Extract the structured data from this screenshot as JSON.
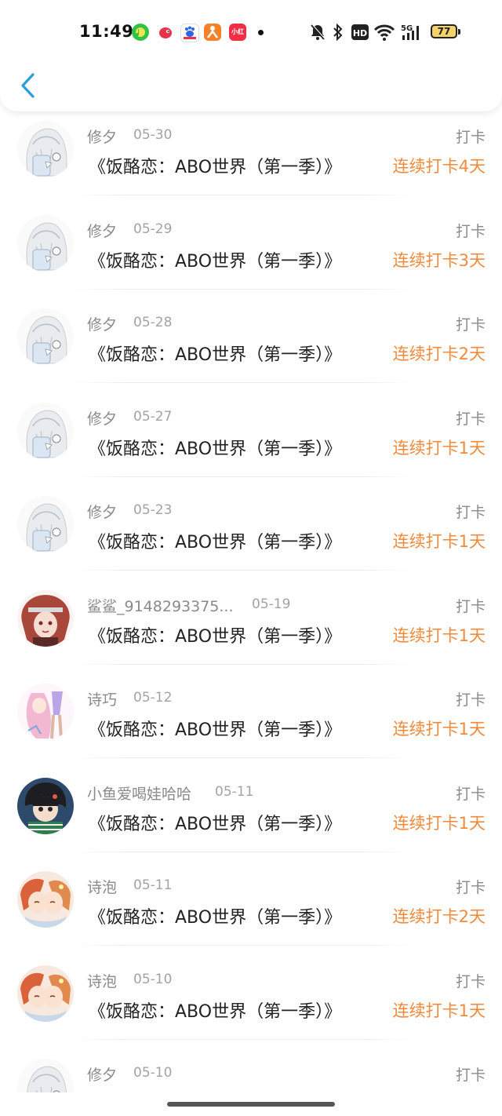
{
  "status_bar": {
    "time": "11:49",
    "app_icons": [
      "music-app-icon",
      "bird-app-icon",
      "baidu-app-icon",
      "person-app-icon",
      "xiaohongshu-app-icon"
    ],
    "xiaohongshu_text": "小红书",
    "battery_level": "77",
    "network": "5G"
  },
  "header": {
    "back_icon": "chevron-left-icon"
  },
  "colors": {
    "streak": "#f08a3c",
    "back": "#2d9cdb",
    "battery_fill": "#f4d46a"
  },
  "entries": [
    {
      "user": "修夕",
      "date": "05-30",
      "action": "打卡",
      "book": "《饭酪恋：ABO世界（第一季）》",
      "streak": "连续打卡4天",
      "avatar": "white-hair"
    },
    {
      "user": "修夕",
      "date": "05-29",
      "action": "打卡",
      "book": "《饭酪恋：ABO世界（第一季）》",
      "streak": "连续打卡3天",
      "avatar": "white-hair"
    },
    {
      "user": "修夕",
      "date": "05-28",
      "action": "打卡",
      "book": "《饭酪恋：ABO世界（第一季）》",
      "streak": "连续打卡2天",
      "avatar": "white-hair"
    },
    {
      "user": "修夕",
      "date": "05-27",
      "action": "打卡",
      "book": "《饭酪恋：ABO世界（第一季）》",
      "streak": "连续打卡1天",
      "avatar": "white-hair"
    },
    {
      "user": "修夕",
      "date": "05-23",
      "action": "打卡",
      "book": "《饭酪恋：ABO世界（第一季）》",
      "streak": "连续打卡1天",
      "avatar": "white-hair"
    },
    {
      "user": "鲨鲨_9148293375...",
      "date": "05-19",
      "action": "打卡",
      "book": "《饭酪恋：ABO世界（第一季）》",
      "streak": "连续打卡1天",
      "avatar": "red-hair"
    },
    {
      "user": "诗巧",
      "date": "05-12",
      "action": "打卡",
      "book": "《饭酪恋：ABO世界（第一季）》",
      "streak": "连续打卡1天",
      "avatar": "pink-hair"
    },
    {
      "user": "小鱼爱喝娃哈哈",
      "date": "05-11",
      "action": "打卡",
      "book": "《饭酪恋：ABO世界（第一季）》",
      "streak": "连续打卡1天",
      "avatar": "dark-boy"
    },
    {
      "user": "诗泡",
      "date": "05-11",
      "action": "打卡",
      "book": "《饭酪恋：ABO世界（第一季）》",
      "streak": "连续打卡2天",
      "avatar": "orange-couple"
    },
    {
      "user": "诗泡",
      "date": "05-10",
      "action": "打卡",
      "book": "《饭酪恋：ABO世界（第一季）》",
      "streak": "连续打卡1天",
      "avatar": "orange-couple"
    },
    {
      "user": "修夕",
      "date": "05-10",
      "action": "打卡",
      "book": "《饭酪恋：ABO世界（第一季）》",
      "streak": "",
      "avatar": "white-hair"
    }
  ]
}
